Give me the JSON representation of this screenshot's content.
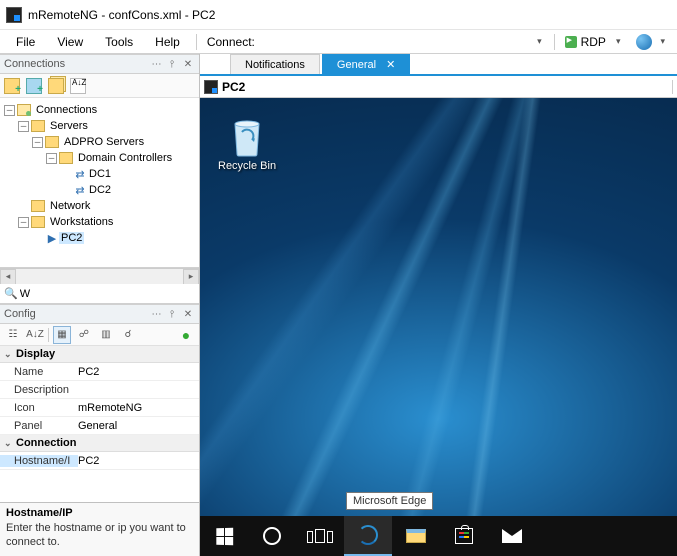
{
  "window": {
    "title": "mRemoteNG - confCons.xml - PC2"
  },
  "menu": {
    "file": "File",
    "view": "View",
    "tools": "Tools",
    "help": "Help",
    "connect": "Connect:",
    "rdp": "RDP"
  },
  "panels": {
    "connections": {
      "title": "Connections"
    },
    "config": {
      "title": "Config"
    }
  },
  "tree": {
    "root": "Connections",
    "servers": "Servers",
    "adpro": "ADPRO Servers",
    "dcs": "Domain Controllers",
    "dc1": "DC1",
    "dc2": "DC2",
    "network": "Network",
    "workstations": "Workstations",
    "pc2": "PC2"
  },
  "search": {
    "value": "W"
  },
  "sort_label": "A↓Z",
  "config_props": {
    "cat_display": "Display",
    "name_k": "Name",
    "name_v": "PC2",
    "desc_k": "Description",
    "desc_v": "",
    "icon_k": "Icon",
    "icon_v": "mRemoteNG",
    "panel_k": "Panel",
    "panel_v": "General",
    "cat_conn": "Connection",
    "host_k": "Hostname/I",
    "host_v": "PC2"
  },
  "help": {
    "title": "Hostname/IP",
    "desc": "Enter the hostname or ip you want to connect to."
  },
  "tabs": {
    "notifications": "Notifications",
    "general": "General"
  },
  "address": {
    "value": "PC2"
  },
  "desktop": {
    "recyclebin": "Recycle Bin",
    "tooltip": "Microsoft Edge"
  }
}
